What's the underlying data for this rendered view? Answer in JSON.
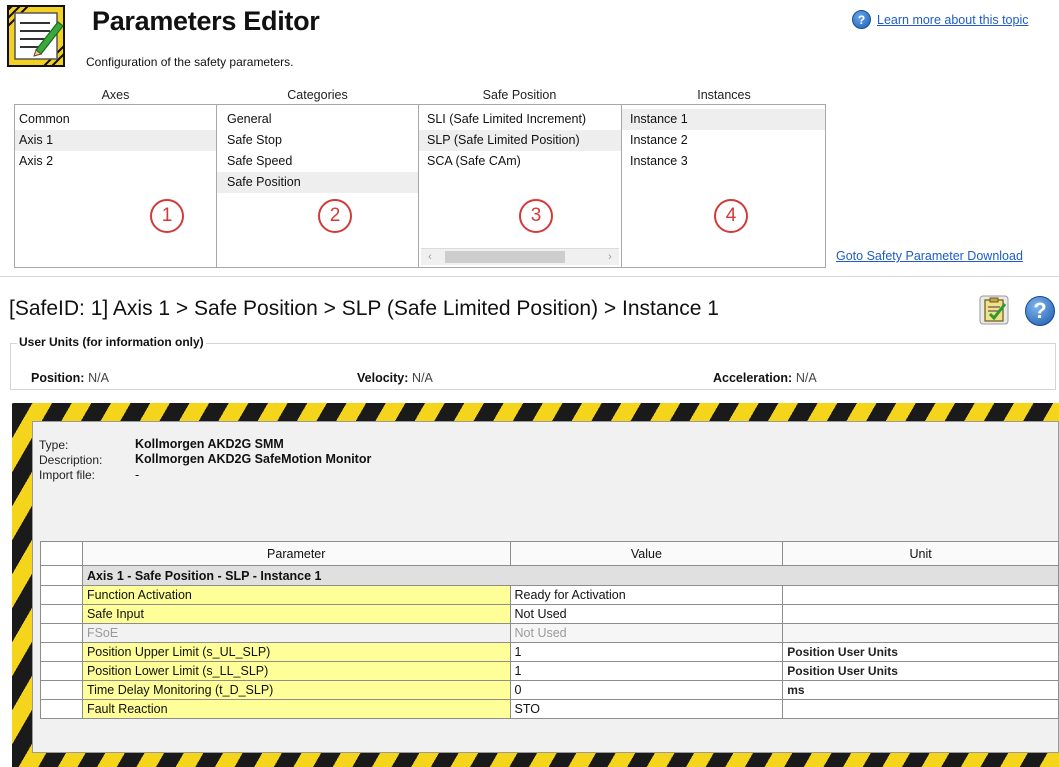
{
  "header": {
    "title": "Parameters Editor",
    "subtitle": "Configuration of the safety parameters.",
    "help_link": "Learn more about this topic",
    "app_icon": "parameters-editor-icon"
  },
  "selectors": {
    "axes": {
      "header": "Axes",
      "items": [
        "Common",
        "Axis 1",
        "Axis 2"
      ],
      "marker": "1"
    },
    "categories": {
      "header": "Categories",
      "items": [
        "General",
        "Safe Stop",
        "Safe Speed",
        "Safe Position"
      ],
      "marker": "2"
    },
    "safe_position": {
      "header": "Safe Position",
      "items": [
        "SLI (Safe Limited Increment)",
        "SLP (Safe Limited Position)",
        "SCA (Safe CAm)"
      ],
      "marker": "3"
    },
    "instances": {
      "header": "Instances",
      "items": [
        "Instance 1",
        "Instance 2",
        "Instance 3"
      ],
      "marker": "4"
    },
    "goto_link": "Goto Safety Parameter Download"
  },
  "breadcrumb": "[SafeID: 1]  Axis 1 > Safe Position > SLP (Safe Limited Position) > Instance 1",
  "user_units": {
    "title": "User Units (for information only)",
    "position_label": "Position:",
    "position_value": "N/A",
    "velocity_label": "Velocity:",
    "velocity_value": "N/A",
    "acceleration_label": "Acceleration:",
    "acceleration_value": "N/A"
  },
  "device": {
    "type_label": "Type:",
    "type_value": "Kollmorgen AKD2G SMM",
    "description_label": "Description:",
    "description_value": "Kollmorgen AKD2G SafeMotion Monitor",
    "import_label": "Import file:",
    "import_value": "-"
  },
  "table": {
    "headers": [
      "Parameter",
      "Value",
      "Unit"
    ],
    "group": "Axis 1 - Safe Position - SLP - Instance 1",
    "rows": [
      {
        "param": "Function Activation",
        "value": "Ready for Activation",
        "unit": ""
      },
      {
        "param": "Safe Input",
        "value": "Not Used",
        "unit": ""
      },
      {
        "param": "FSoE",
        "value": "Not Used",
        "unit": ""
      },
      {
        "param": "Position Upper Limit (s_UL_SLP)",
        "value": "1",
        "unit": "Position User Units"
      },
      {
        "param": "Position Lower Limit (s_LL_SLP)",
        "value": "1",
        "unit": "Position User Units"
      },
      {
        "param": "Time Delay Monitoring (t_D_SLP)",
        "value": "0",
        "unit": "ms"
      },
      {
        "param": "Fault Reaction",
        "value": "STO",
        "unit": ""
      }
    ]
  },
  "colors": {
    "link": "#1f5cc8",
    "marker": "#d23a3a",
    "editable_cell": "#ffff99",
    "hazard_yellow": "#f4d51b",
    "hazard_black": "#1a1a1a"
  }
}
